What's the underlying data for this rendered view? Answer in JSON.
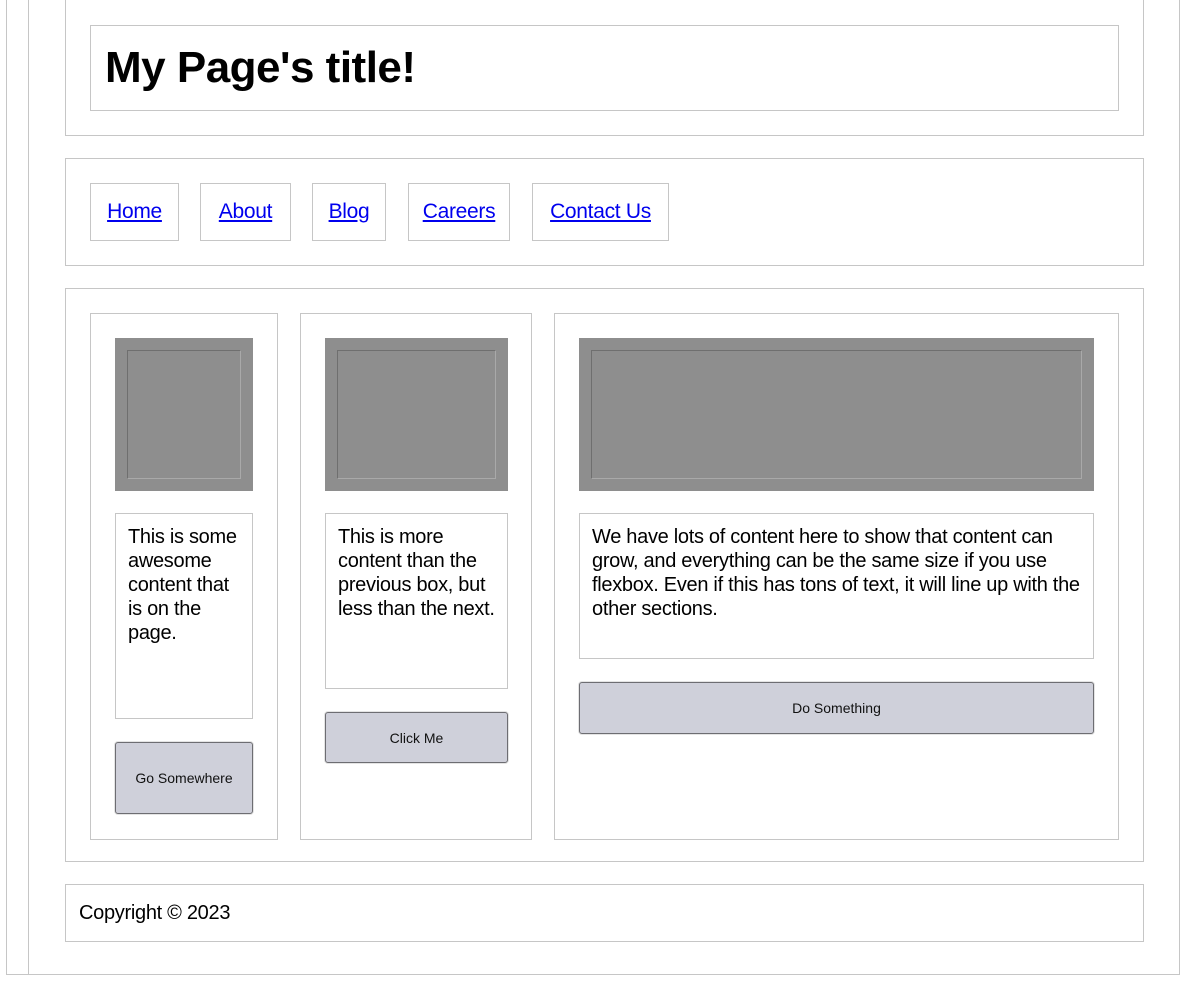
{
  "header": {
    "title": "My Page's title!"
  },
  "nav": {
    "items": [
      {
        "label": "Home"
      },
      {
        "label": "About"
      },
      {
        "label": "Blog"
      },
      {
        "label": "Careers"
      },
      {
        "label": "Contact Us"
      }
    ]
  },
  "cards": [
    {
      "text": "This is some awesome content that is on the page.",
      "button": "Go Somewhere"
    },
    {
      "text": "This is more content than the previous box, but less than the next.",
      "button": "Click Me"
    },
    {
      "text": "We have lots of content here to show that content can grow, and everything can be the same size if you use flexbox. Even if this has tons of text, it will line up with the other sections.",
      "button": "Do Something"
    }
  ],
  "footer": {
    "copyright": "Copyright © 2023"
  },
  "colors": {
    "link": "#0000ee",
    "border": "#c6c6c6",
    "image_placeholder": "#8e8e8e",
    "button_bg": "#cfd0da"
  }
}
